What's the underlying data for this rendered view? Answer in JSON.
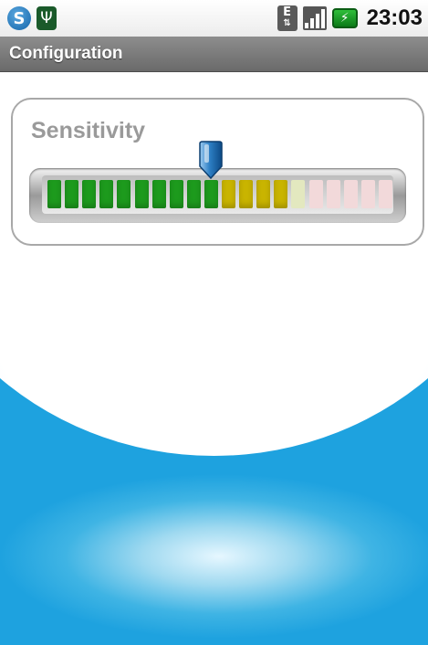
{
  "status_bar": {
    "time": "23:03",
    "icons": [
      "skype-icon",
      "usb-icon",
      "data-transfer-icon",
      "signal-icon",
      "battery-icon"
    ]
  },
  "title_bar": {
    "title": "Configuration"
  },
  "sensitivity": {
    "label": "Sensitivity",
    "level": 9,
    "segments": 20,
    "segment_colors": {
      "green": "#1d9a1d",
      "yellow": "#c9b400",
      "yellow_faint": "#e3e8bf",
      "pink_faint": "#f2d9da"
    }
  }
}
